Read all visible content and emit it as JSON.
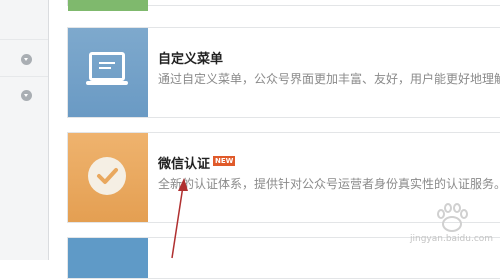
{
  "sidebar": {
    "items": [
      {
        "icon": "expand-icon"
      },
      {
        "icon": "expand-icon"
      }
    ]
  },
  "cards": {
    "custom_menu": {
      "title": "自定义菜单",
      "description": "通过自定义菜单，公众号界面更加丰富、友好，用户能更好地理解",
      "icon": "menu-icon",
      "color": "#739fc9"
    },
    "verification": {
      "title": "微信认证",
      "badge": "NEW",
      "description": "全新的认证体系，提供针对公众号运营者身份真实性的认证服务。",
      "icon": "check-icon",
      "color": "#e9a85e"
    }
  },
  "annotation": {
    "color": "#b03030",
    "icon": "pointer-arrow"
  },
  "watermark": {
    "text": "jingyan.baidu.com"
  }
}
